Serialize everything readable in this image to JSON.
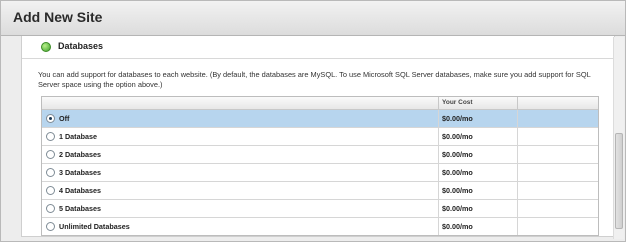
{
  "window": {
    "title": "Add New Site"
  },
  "section": {
    "title": "Databases",
    "description": "You can add support for databases to each website. (By default, the databases are MySQL. To use Microsoft SQL Server databases, make sure you add support for SQL Server space using the option above.)"
  },
  "table": {
    "cost_header": "Your Cost",
    "rows": [
      {
        "label": "Off",
        "cost": "$0.00/mo",
        "selected": true
      },
      {
        "label": "1 Database",
        "cost": "$0.00/mo",
        "selected": false
      },
      {
        "label": "2 Databases",
        "cost": "$0.00/mo",
        "selected": false
      },
      {
        "label": "3 Databases",
        "cost": "$0.00/mo",
        "selected": false
      },
      {
        "label": "4 Databases",
        "cost": "$0.00/mo",
        "selected": false
      },
      {
        "label": "5 Databases",
        "cost": "$0.00/mo",
        "selected": false
      },
      {
        "label": "Unlimited Databases",
        "cost": "$0.00/mo",
        "selected": false
      }
    ]
  },
  "colors": {
    "selected_row": "#b7d5ee",
    "section_icon": "#3ea12b"
  },
  "icons": {
    "section": "green-bullet-icon"
  }
}
